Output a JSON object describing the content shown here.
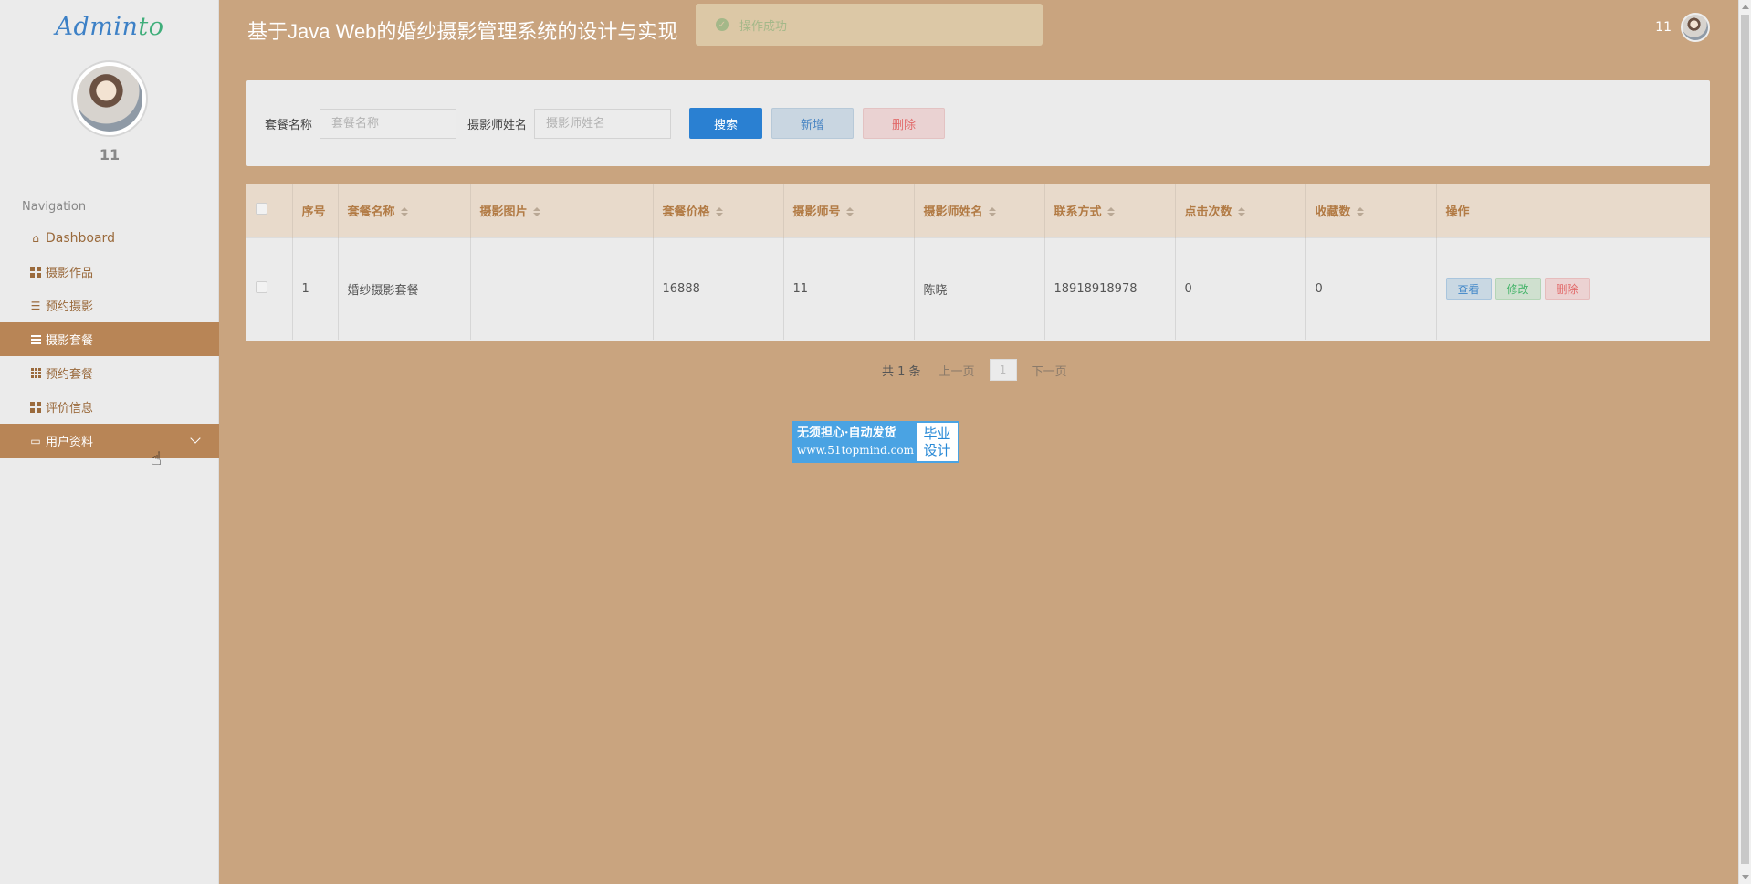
{
  "sidebar": {
    "brand_main": "Admin",
    "brand_accent": "to",
    "user_name": "11",
    "nav_title": "Navigation",
    "items": [
      {
        "label": "Dashboard"
      },
      {
        "label": "摄影作品"
      },
      {
        "label": "预约摄影"
      },
      {
        "label": "摄影套餐"
      },
      {
        "label": "预约套餐"
      },
      {
        "label": "评价信息"
      },
      {
        "label": "用户资料"
      }
    ]
  },
  "header": {
    "title": "基于Java Web的婚纱摄影管理系统的设计与实现",
    "user": "11"
  },
  "toast": {
    "message": "操作成功"
  },
  "search": {
    "package_label": "套餐名称",
    "package_placeholder": "套餐名称",
    "photographer_label": "摄影师姓名",
    "photographer_placeholder": "摄影师姓名",
    "search_btn": "搜索",
    "add_btn": "新增",
    "delete_btn": "删除"
  },
  "table": {
    "headers": [
      "序号",
      "套餐名称",
      "摄影图片",
      "套餐价格",
      "摄影师号",
      "摄影师姓名",
      "联系方式",
      "点击次数",
      "收藏数",
      "操作"
    ],
    "rows": [
      {
        "index": "1",
        "package_name": "婚纱摄影套餐",
        "image": "",
        "price": "16888",
        "photographer_no": "11",
        "photographer_name": "陈晓",
        "contact": "18918918978",
        "clicks": "0",
        "favorites": "0"
      }
    ],
    "actions": {
      "view": "查看",
      "edit": "修改",
      "delete": "删除"
    }
  },
  "pagination": {
    "total": "共 1 条",
    "prev": "上一页",
    "current": "1",
    "next": "下一页"
  },
  "banner": {
    "line1": "无须担心·自动发货",
    "line2": "www.51topmind.com",
    "right1": "毕业",
    "right2": "设计"
  },
  "colors": {
    "background": "#c9a47f",
    "sidebar_active": "#b88556",
    "primary": "#2a80d2"
  }
}
